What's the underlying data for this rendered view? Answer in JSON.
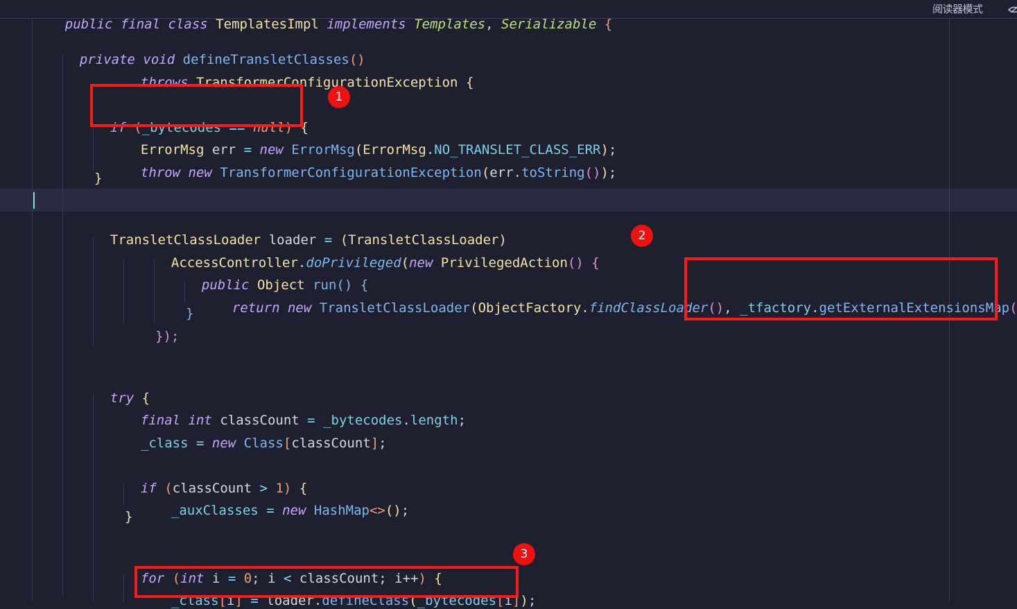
{
  "toolbar": {
    "reader_mode_label": "阅读器模式",
    "eye_icon": "eye-off-icon"
  },
  "code": {
    "class_header": {
      "kw1": "public",
      "kw2": "final",
      "kw3": "class",
      "name": "TemplatesImpl",
      "kw4": "implements",
      "iface1": "Templates",
      "sep": ",",
      "iface2": "Serializable",
      "brace": "{"
    },
    "method_sig": {
      "kw1": "private",
      "kw2": "void",
      "name": "defineTransletClasses",
      "parens": "()"
    },
    "throws_line": {
      "kw": "throws",
      "exc": "TransformerConfigurationException",
      "brace": "{"
    },
    "if_null": {
      "kw": "if",
      "lp": "(",
      "field": "_bytecodes",
      "op": "==",
      "nul": "null",
      "rp": ")",
      "brace": "{"
    },
    "errormsg_line": {
      "type": "ErrorMsg",
      "var": "err",
      "eq": "=",
      "kw": "new",
      "ctor": "ErrorMsg",
      "lp": "(",
      "cls": "ErrorMsg",
      "dot": ".",
      "const": "NO_TRANSLET_CLASS_ERR",
      "rp": ")",
      "semi": ";"
    },
    "throw_line": {
      "kw1": "throw",
      "kw2": "new",
      "ctor": "TransformerConfigurationException",
      "lp": "(",
      "var": "err",
      "dot": ".",
      "call": "toString",
      "inner": "()",
      "rp": ")",
      "semi": ";"
    },
    "close1": "}",
    "loader_line": {
      "type": "TransletClassLoader",
      "var": "loader",
      "eq": "=",
      "cast": "(TransletClassLoader)"
    },
    "access_line": {
      "cls": "AccessController",
      "dot": ".",
      "call": "doPrivileged",
      "lp": "(",
      "kw": "new",
      "iface": "PrivilegedAction",
      "paren": "()",
      "brace": "{"
    },
    "run_line": {
      "kw": "public",
      "type": "Object",
      "name": "run",
      "paren": "()",
      "brace": "{"
    },
    "return_line": {
      "kw1": "return",
      "kw2": "new",
      "ctor": "TransletClassLoader",
      "lp": "(",
      "cls": "ObjectFactory",
      "dot": ".",
      "call": "findClassLoader",
      "inner": "()",
      "comma": ",",
      "field": "_tfactory",
      "dot2": ".",
      "call2": "getExternalExtensionsMap",
      "inner2": "()",
      "rp": ")",
      "semi": ";"
    },
    "close2": "}",
    "close3": "});",
    "try_line": {
      "kw": "try",
      "brace": "{"
    },
    "classcount_line": {
      "kw1": "final",
      "kw2": "int",
      "var": "classCount",
      "eq": "=",
      "field": "_bytecodes",
      "dot": ".",
      "prop": "length",
      "semi": ";"
    },
    "class_line": {
      "field": "_class",
      "eq": "=",
      "kw": "new",
      "ctor": "Class",
      "lb": "[",
      "var": "classCount",
      "rb": "]",
      "semi": ";"
    },
    "if_count": {
      "kw": "if",
      "lp": "(",
      "var": "classCount",
      "op": ">",
      "num": "1",
      "rp": ")",
      "brace": "{"
    },
    "aux_line": {
      "field": "_auxClasses",
      "eq": "=",
      "kw": "new",
      "ctor": "HashMap",
      "diamond": "<>",
      "paren": "()",
      "semi": ";"
    },
    "close4": "}",
    "for_line": {
      "kw": "for",
      "lp": "(",
      "kw2": "int",
      "var": "i",
      "eq": "=",
      "num": "0",
      "semi1": ";",
      "var2": "i",
      "op": "<",
      "var3": "classCount",
      "semi2": ";",
      "inc": "i++",
      "rp": ")",
      "brace": "{"
    },
    "define_line": {
      "field": "_class",
      "lb": "[",
      "idx": "i",
      "rb": "]",
      "eq": "=",
      "var": "loader",
      "dot": ".",
      "call": "defineClass",
      "lp": "(",
      "field2": "_bytecodes",
      "lb2": "[",
      "idx2": "i",
      "rb2": "]",
      "rp": ")",
      "semi": ";"
    }
  },
  "annotations": {
    "marker1": "1",
    "marker2": "2",
    "marker3": "3"
  }
}
